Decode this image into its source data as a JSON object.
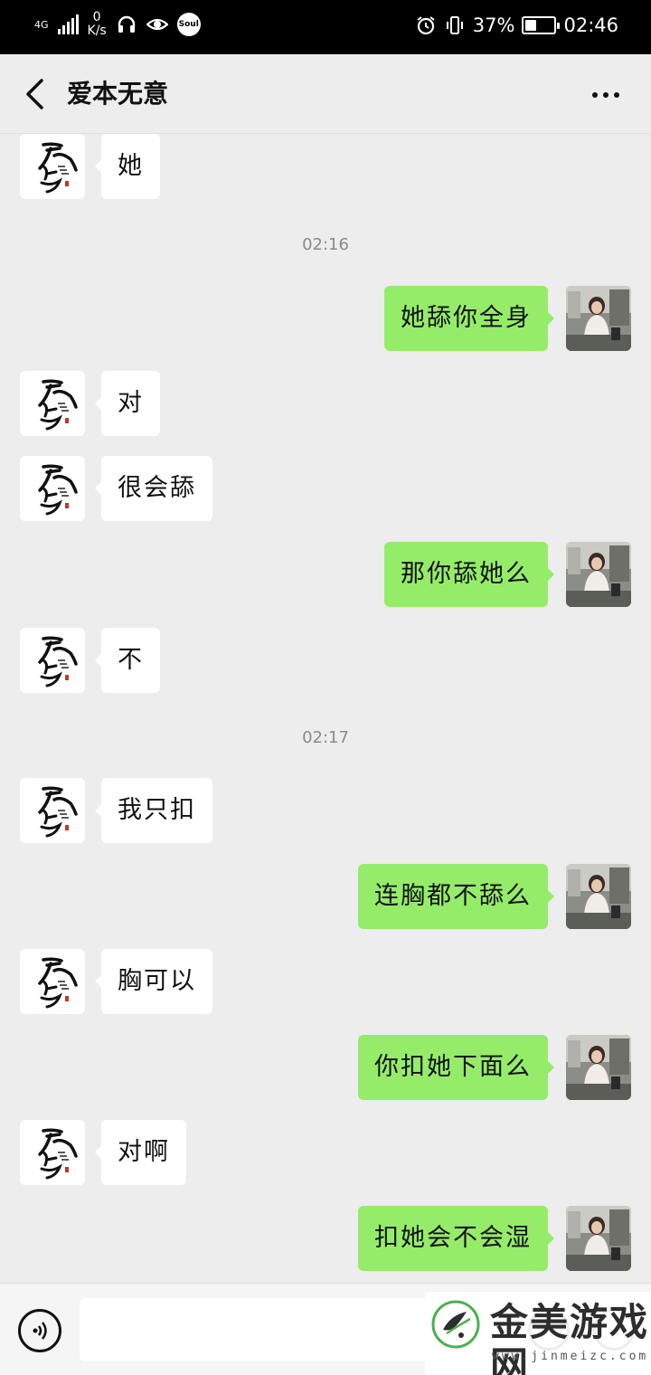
{
  "status_bar": {
    "network": "4G",
    "speed_value": "0",
    "speed_unit": "K/s",
    "soul_label": "Soul",
    "battery": "37%",
    "battery_level": 0.37,
    "time": "02:46"
  },
  "header": {
    "title": "爱本无意",
    "back_icon": "chevron-left-icon",
    "more_icon": "ellipsis-icon"
  },
  "messages": [
    {
      "side": "left",
      "text": "她"
    },
    {
      "type": "time",
      "text": "02:16"
    },
    {
      "side": "right",
      "text": "她舔你全身"
    },
    {
      "side": "left",
      "text": "对"
    },
    {
      "side": "left",
      "text": "很会舔"
    },
    {
      "side": "right",
      "text": "那你舔她么"
    },
    {
      "side": "left",
      "text": "不"
    },
    {
      "type": "time",
      "text": "02:17"
    },
    {
      "side": "left",
      "text": "我只扣"
    },
    {
      "side": "right",
      "text": "连胸都不舔么"
    },
    {
      "side": "left",
      "text": "胸可以"
    },
    {
      "side": "right",
      "text": "你扣她下面么"
    },
    {
      "side": "left",
      "text": "对啊"
    },
    {
      "side": "right",
      "text": "扣她会不会湿"
    }
  ],
  "input_bar": {
    "voice_icon": "voice-icon",
    "message_value": "",
    "emoji_icon": "emoji-icon",
    "plus_icon": "plus-icon"
  },
  "watermark": {
    "text": "金美游戏网",
    "url": "www.jinmeizc.com"
  },
  "colors": {
    "background": "#ededed",
    "outgoing_bubble": "#95ec69",
    "incoming_bubble": "#ffffff",
    "timestamp": "#8a8a8a"
  }
}
